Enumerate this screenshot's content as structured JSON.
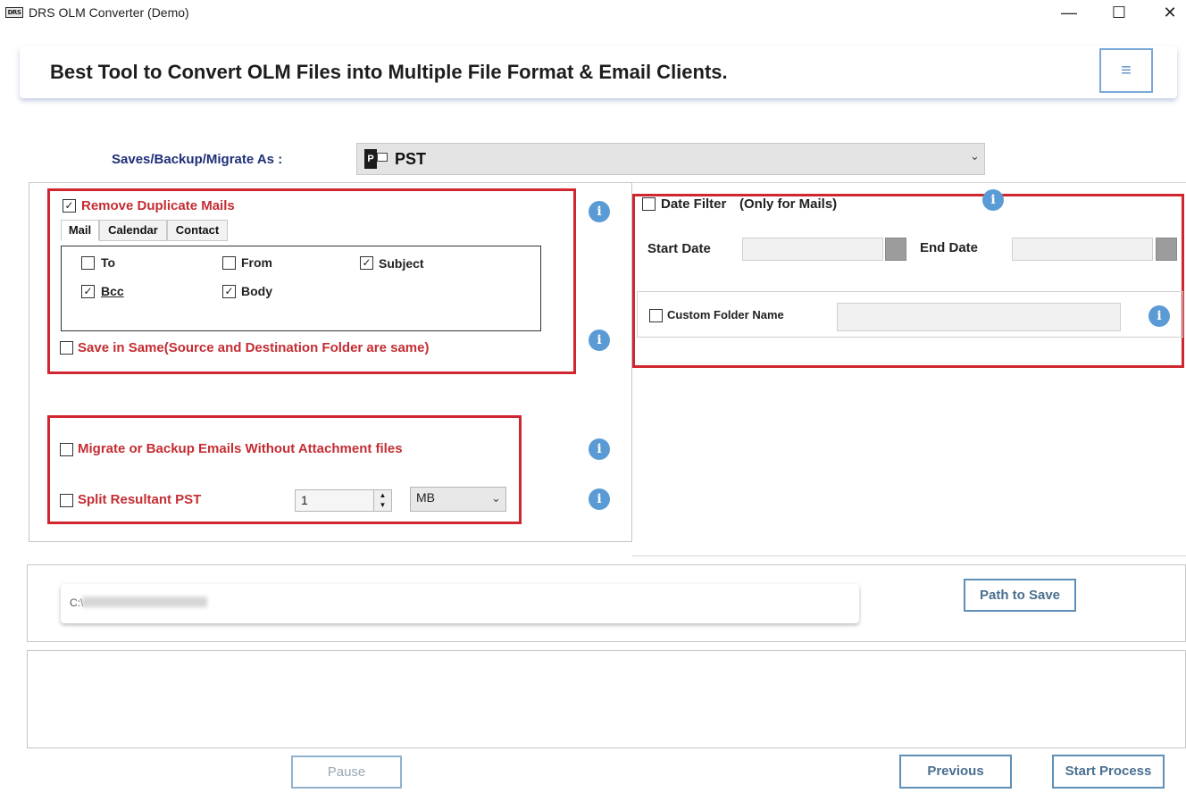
{
  "window": {
    "logo_text": "DRS",
    "title": "DRS OLM Converter (Demo)",
    "minimize": "—",
    "maximize": "☐",
    "close": "✕"
  },
  "banner": {
    "headline": "Best Tool to Convert OLM Files into Multiple File Format & Email Clients.",
    "menu_icon": "hamburger-menu-icon",
    "menu_glyph": "≡"
  },
  "format": {
    "label": "Saves/Backup/Migrate As :",
    "icon": "outlook-pst-icon",
    "icon_letter": "P",
    "selected": "PST",
    "chevron": "⌄"
  },
  "duplicates": {
    "checked": true,
    "label": "Remove Duplicate Mails",
    "tabs": [
      {
        "label": "Mail",
        "active": true
      },
      {
        "label": "Calendar",
        "active": false
      },
      {
        "label": "Contact",
        "active": false
      }
    ],
    "fields": [
      {
        "label": "To",
        "checked": false
      },
      {
        "label": "From",
        "checked": false
      },
      {
        "label": "Subject",
        "checked": true
      },
      {
        "label": "Bcc",
        "checked": true
      },
      {
        "label": "Body",
        "checked": true
      }
    ]
  },
  "save_in_same": {
    "checked": false,
    "label": "Save in Same(Source and Destination Folder are same)"
  },
  "without_attachments": {
    "checked": false,
    "label": "Migrate or Backup Emails Without Attachment files"
  },
  "split_pst": {
    "checked": false,
    "label": "Split Resultant PST",
    "size_value": "1",
    "unit": "MB",
    "unit_chevron": "⌄"
  },
  "date_filter": {
    "checked": false,
    "label": "Date Filter",
    "note": "(Only for Mails)",
    "start_label": "Start Date",
    "start_value": "",
    "end_label": "End Date",
    "end_value": ""
  },
  "custom_folder": {
    "checked": false,
    "label": "Custom Folder Name",
    "value": ""
  },
  "info_glyph": "i",
  "path": {
    "value": "C:\\",
    "button": "Path to Save"
  },
  "footer": {
    "pause": "Pause",
    "previous": "Previous",
    "start": "Start Process"
  },
  "colors": {
    "highlight_border": "#d0262f",
    "option_text": "#c42d33",
    "label_navy": "#1f2f78",
    "button_border": "#5f8fb8",
    "info_blue": "#5b9bd5"
  }
}
